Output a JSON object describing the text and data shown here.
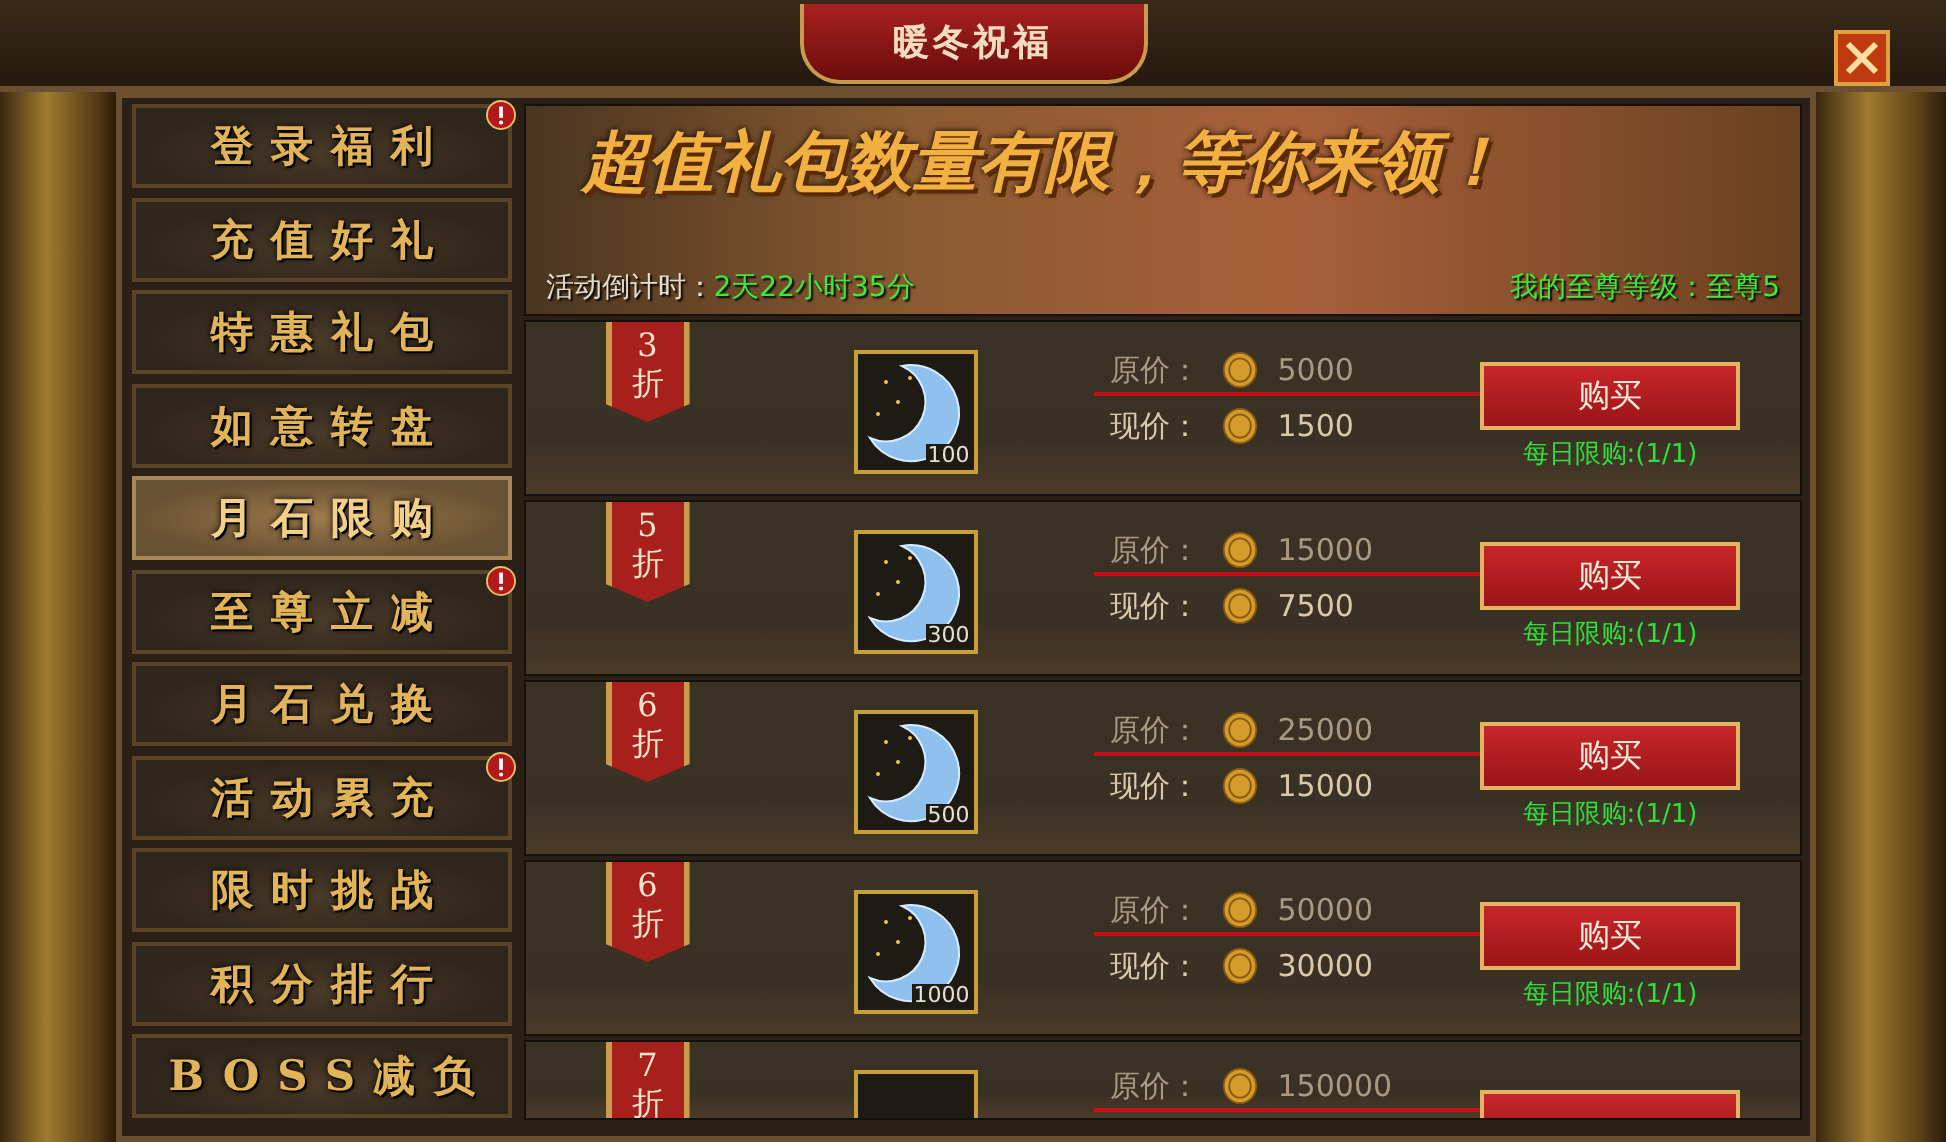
{
  "window": {
    "title": "暖冬祝福"
  },
  "sidebar": {
    "items": [
      {
        "label": "登录福利",
        "selected": false,
        "alert": true
      },
      {
        "label": "充值好礼",
        "selected": false,
        "alert": false
      },
      {
        "label": "特惠礼包",
        "selected": false,
        "alert": false
      },
      {
        "label": "如意转盘",
        "selected": false,
        "alert": false
      },
      {
        "label": "月石限购",
        "selected": true,
        "alert": false
      },
      {
        "label": "至尊立减",
        "selected": false,
        "alert": true
      },
      {
        "label": "月石兑换",
        "selected": false,
        "alert": false
      },
      {
        "label": "活动累充",
        "selected": false,
        "alert": true
      },
      {
        "label": "限时挑战",
        "selected": false,
        "alert": false
      },
      {
        "label": "积分排行",
        "selected": false,
        "alert": false
      },
      {
        "label": "BOSS减负",
        "selected": false,
        "alert": false
      }
    ]
  },
  "banner": {
    "headline": "超值礼包数量有限，等你来领！",
    "countdown_label": "活动倒计时：",
    "countdown_value": "2天22小时35分",
    "level_text": "我的至尊等级：至尊5"
  },
  "offers": [
    {
      "discount": "3",
      "discount_unit": "折",
      "quantity": "100",
      "original_label": "原价：",
      "original_price": "5000",
      "current_label": "现价：",
      "current_price": "1500",
      "button": "购买",
      "limit": "每日限购:(1/1)"
    },
    {
      "discount": "5",
      "discount_unit": "折",
      "quantity": "300",
      "original_label": "原价：",
      "original_price": "15000",
      "current_label": "现价：",
      "current_price": "7500",
      "button": "购买",
      "limit": "每日限购:(1/1)"
    },
    {
      "discount": "6",
      "discount_unit": "折",
      "quantity": "500",
      "original_label": "原价：",
      "original_price": "25000",
      "current_label": "现价：",
      "current_price": "15000",
      "button": "购买",
      "limit": "每日限购:(1/1)"
    },
    {
      "discount": "6",
      "discount_unit": "折",
      "quantity": "1000",
      "original_label": "原价：",
      "original_price": "50000",
      "current_label": "现价：",
      "current_price": "30000",
      "button": "购买",
      "limit": "每日限购:(1/1)"
    },
    {
      "discount": "7",
      "discount_unit": "折",
      "original_label": "原价：",
      "original_price": "150000"
    }
  ]
}
